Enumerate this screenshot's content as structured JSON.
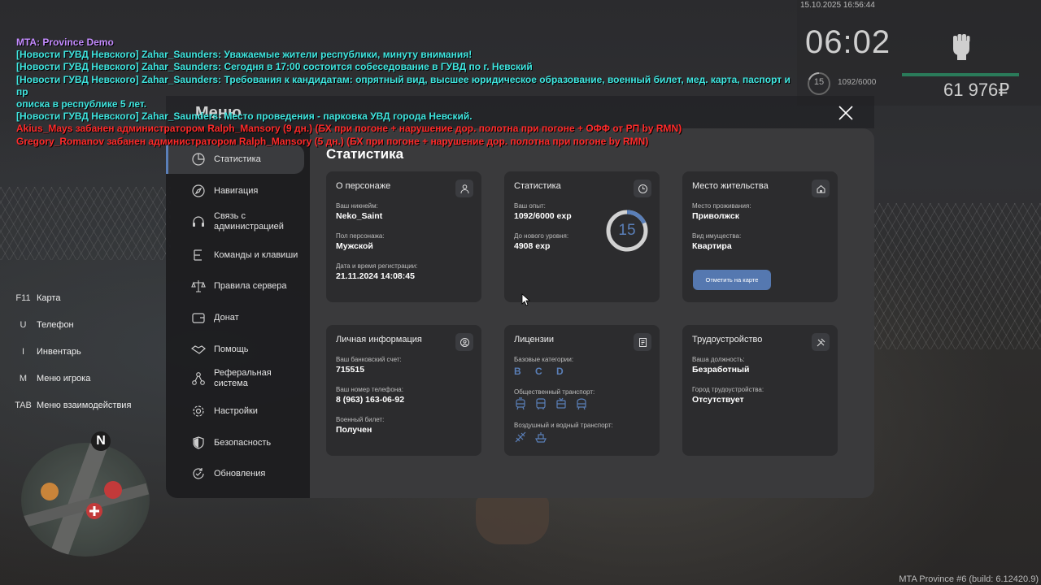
{
  "chat": {
    "lines": [
      {
        "type": "title",
        "text": "MTA: Province Demo"
      },
      {
        "type": "news",
        "text": "[Новости ГУВД Невского] Zahar_Saunders: Уважаемые жители республики, минуту внимания!"
      },
      {
        "type": "news",
        "text": "[Новости ГУВД Невского] Zahar_Saunders: Сегодня в 17:00 состоится собеседование в ГУВД по г. Невский"
      },
      {
        "type": "news",
        "text": "[Новости ГУВД Невского] Zahar_Saunders: Требования к кандидатам: опрятный вид, высшее юридическое образование, военный билет, мед. карта, паспорт и пр"
      },
      {
        "type": "news",
        "text": "описка в республике 5 лет."
      },
      {
        "type": "news",
        "text": "[Новости ГУВД Невского] Zahar_Saunders: Место проведения - парковка УВД города Невский."
      },
      {
        "type": "ban",
        "text": "Akius_Mays забанен администратором Ralph_Mansory (9 дн.) (БХ при погоне + нарушение дор. полотна при погоне + ОФФ от РП by RMN)"
      },
      {
        "type": "ban",
        "text": "Gregory_Romanov забанен администратором Ralph_Mansory (5 дн.) (БХ при погоне + нарушение дор. полотна при погоне by RMN)"
      }
    ]
  },
  "hud": {
    "datetime": "15.10.2025 16:56:44",
    "time": "06:02",
    "level": "15",
    "exp": "1092/6000",
    "money": "61 976₽"
  },
  "keys": [
    {
      "key": "F11",
      "label": "Карта"
    },
    {
      "key": "U",
      "label": "Телефон"
    },
    {
      "key": "I",
      "label": "Инвентарь"
    },
    {
      "key": "M",
      "label": "Меню игрока"
    },
    {
      "key": "TAB",
      "label": "Меню взаимодействия"
    }
  ],
  "minimap": {
    "north": "N"
  },
  "menu": {
    "title": "Меню",
    "page_title": "Статистика",
    "nav": [
      {
        "label": "Статистика",
        "icon": "pie-chart-icon",
        "active": true
      },
      {
        "label": "Навигация",
        "icon": "compass-icon"
      },
      {
        "label": "Связь с администрацией",
        "icon": "headset-icon"
      },
      {
        "label": "Команды и клавиши",
        "icon": "list-icon"
      },
      {
        "label": "Правила сервера",
        "icon": "scales-icon"
      },
      {
        "label": "Донат",
        "icon": "wallet-icon"
      },
      {
        "label": "Помощь",
        "icon": "handshake-icon"
      },
      {
        "label": "Реферальная система",
        "icon": "network-icon"
      },
      {
        "label": "Настройки",
        "icon": "gear-icon"
      },
      {
        "label": "Безопасность",
        "icon": "shield-icon"
      },
      {
        "label": "Обновления",
        "icon": "refresh-icon"
      }
    ],
    "cards": {
      "character": {
        "title": "О персонаже",
        "nick_label": "Ваш никнейм:",
        "nick": "Neko_Saint",
        "sex_label": "Пол персонажа:",
        "sex": "Мужской",
        "reg_label": "Дата и время регистрации:",
        "reg": "21.11.2024 14:08:45"
      },
      "stats": {
        "title": "Статистика",
        "exp_label": "Ваш опыт:",
        "exp": "1092/6000 exp",
        "next_label": "До нового уровня:",
        "next": "4908 exp",
        "level": "15",
        "progress": 0.182
      },
      "residence": {
        "title": "Место жительства",
        "place_label": "Место проживания:",
        "place": "Приволжск",
        "type_label": "Вид имущества:",
        "type": "Квартира",
        "button": "Отметить на карте"
      },
      "personal": {
        "title": "Личная информация",
        "bank_label": "Ваш банковский счет:",
        "bank": "715515",
        "phone_label": "Ваш номер телефона:",
        "phone": "8 (963) 163-06-92",
        "military_label": "Военный билет:",
        "military": "Получен"
      },
      "licenses": {
        "title": "Лицензии",
        "base_label": "Базовые категории:",
        "base": "B C D",
        "public_label": "Общественный транспорт:",
        "air_label": "Воздушный и водный транспорт:"
      },
      "job": {
        "title": "Трудоустройство",
        "position_label": "Ваша должность:",
        "position": "Безработный",
        "city_label": "Город трудоустройства:",
        "city": "Отсутствует"
      }
    }
  },
  "build": "MTA Province #6 (build: 6.12420.9)",
  "colors": {
    "accent": "#5a7fb8",
    "news": "#3fe6e0",
    "ban": "#ff2a2a",
    "title": "#c48bff"
  }
}
